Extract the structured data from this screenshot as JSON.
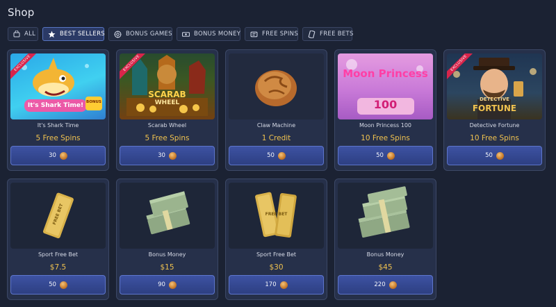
{
  "page": {
    "title": "Shop"
  },
  "tabs": [
    {
      "label": "ALL",
      "icon": "bag-icon",
      "active": false
    },
    {
      "label": "BEST SELLERS",
      "icon": "star-icon",
      "active": true
    },
    {
      "label": "BONUS GAMES",
      "icon": "chip-icon",
      "active": false
    },
    {
      "label": "BONUS MONEY",
      "icon": "cash-icon",
      "active": false
    },
    {
      "label": "FREE SPINS",
      "icon": "ticket-icon",
      "active": false
    },
    {
      "label": "FREE BETS",
      "icon": "slip-icon",
      "active": false
    }
  ],
  "cards": [
    {
      "name": "It's Shark Time",
      "reward": "5 Free Spins",
      "price": "30",
      "badge": "EXCLUSIVE",
      "art_text": "It's Shark Time!",
      "art_subtext": "BONUS",
      "icon": "shark-game-thumbnail"
    },
    {
      "name": "Scarab Wheel",
      "reward": "5 Free Spins",
      "price": "30",
      "badge": "EXCLUSIVE",
      "art_text": "SCARAB",
      "art_subtext": "WHEEL",
      "icon": "scarab-game-thumbnail"
    },
    {
      "name": "Claw Machine",
      "reward": "1 Credit",
      "price": "50",
      "badge": "",
      "icon": "claw-coin-icon"
    },
    {
      "name": "Moon Princess 100",
      "reward": "10 Free Spins",
      "price": "50",
      "badge": "",
      "art_text": "Moon Princess",
      "art_subtext": "100",
      "icon": "moon-princess-thumbnail"
    },
    {
      "name": "Detective Fortune",
      "reward": "10 Free Spins",
      "price": "50",
      "badge": "EXCLUSIVE",
      "art_text": "DETECTIVE",
      "art_subtext": "FORTUNE",
      "icon": "detective-game-thumbnail"
    },
    {
      "name": "Sport Free Bet",
      "reward": "$7.5",
      "price": "50",
      "badge": "",
      "art_text": "FREE BET",
      "icon": "free-bet-ticket-icon"
    },
    {
      "name": "Bonus Money",
      "reward": "$15",
      "price": "90",
      "badge": "",
      "icon": "cash-stack-icon"
    },
    {
      "name": "Sport Free Bet",
      "reward": "$30",
      "price": "170",
      "badge": "",
      "art_text": "FREE BET",
      "icon": "free-bet-tickets-icon"
    },
    {
      "name": "Bonus Money",
      "reward": "$45",
      "price": "220",
      "badge": "",
      "icon": "cash-stacks-icon"
    }
  ],
  "colors": {
    "background": "#1b2233",
    "card": "#26304a",
    "accent": "#3d52a2",
    "reward": "#f0c24f"
  }
}
